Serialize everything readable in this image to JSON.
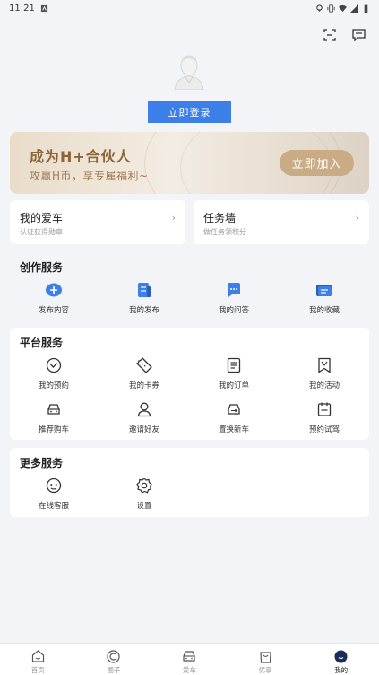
{
  "status_bar": {
    "time": "11:21"
  },
  "header": {
    "login_label": "立即登录"
  },
  "banner": {
    "title": "成为H+合伙人",
    "subtitle": "攻赢H币，享专属福利~",
    "button_label": "立即加入"
  },
  "quick_cards": [
    {
      "title": "我的爱车",
      "subtitle": "认证获得勋章",
      "arrow": "›"
    },
    {
      "title": "任务墙",
      "subtitle": "做任务领积分",
      "arrow": "›"
    }
  ],
  "creation_services": {
    "title": "创作服务",
    "items": [
      {
        "label": "发布内容",
        "icon": "publish-icon"
      },
      {
        "label": "我的发布",
        "icon": "document-icon"
      },
      {
        "label": "我的问答",
        "icon": "chat-icon"
      },
      {
        "label": "我的收藏",
        "icon": "folder-icon"
      }
    ]
  },
  "platform_services": {
    "title": "平台服务",
    "items": [
      {
        "label": "我的预约",
        "icon": "check-circle-icon"
      },
      {
        "label": "我的卡券",
        "icon": "ticket-icon"
      },
      {
        "label": "我的订单",
        "icon": "order-icon"
      },
      {
        "label": "我的活动",
        "icon": "bookmark-icon"
      },
      {
        "label": "推荐购车",
        "icon": "car-icon"
      },
      {
        "label": "邀请好友",
        "icon": "user-icon"
      },
      {
        "label": "置换新车",
        "icon": "car-swap-icon"
      },
      {
        "label": "预约试驾",
        "icon": "calendar-icon"
      }
    ]
  },
  "more_services": {
    "title": "更多服务",
    "items": [
      {
        "label": "在线客服",
        "icon": "service-icon"
      },
      {
        "label": "设置",
        "icon": "settings-icon"
      }
    ]
  },
  "bottom_nav": [
    {
      "label": "首页",
      "icon": "home-icon",
      "active": false
    },
    {
      "label": "圈子",
      "icon": "circle-icon",
      "active": false
    },
    {
      "label": "爱车",
      "icon": "car-icon",
      "active": false
    },
    {
      "label": "优享",
      "icon": "shop-bag-icon",
      "active": false
    },
    {
      "label": "我的",
      "icon": "profile-icon",
      "active": true
    }
  ],
  "colors": {
    "accent": "#3d7fe8",
    "banner_gold": "#c9ab86",
    "banner_text": "#8b6538"
  }
}
